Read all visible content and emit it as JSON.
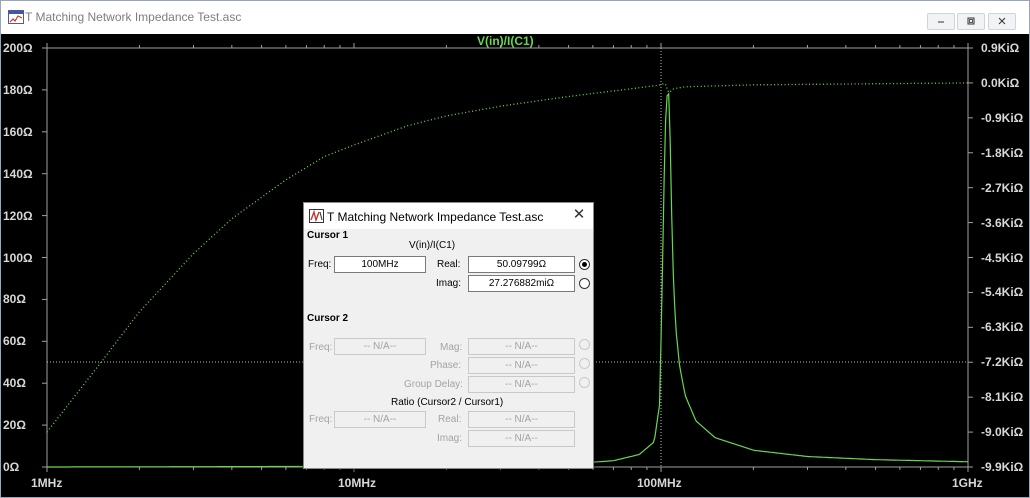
{
  "window": {
    "title": "T Matching Network Impedance Test.asc"
  },
  "chart_data": {
    "type": "line",
    "title": "V(in)/I(C1)",
    "xscale": "log",
    "xlim": [
      "1MHz",
      "1GHz"
    ],
    "x_ticks": [
      "1MHz",
      "10MHz",
      "100MHz",
      "1GHz"
    ],
    "ylim_left": [
      0,
      200
    ],
    "y_ticks_left": [
      "200Ω",
      "180Ω",
      "160Ω",
      "140Ω",
      "120Ω",
      "100Ω",
      "80Ω",
      "60Ω",
      "40Ω",
      "20Ω",
      "0Ω"
    ],
    "ylim_right": [
      -9.9,
      0.9
    ],
    "ylim_right_units": "KiΩ",
    "y_ticks_right": [
      "0.9KiΩ",
      "0.0KiΩ",
      "-0.9KiΩ",
      "-1.8KiΩ",
      "-2.7KiΩ",
      "-3.6KiΩ",
      "-4.5KiΩ",
      "-5.4KiΩ",
      "-6.3KiΩ",
      "-7.2KiΩ",
      "-8.1KiΩ",
      "-9.0KiΩ",
      "-9.9KiΩ"
    ],
    "grid": false,
    "series": [
      {
        "name": "V(in)/I(C1)",
        "part": "magnitude",
        "style": "solid",
        "color": "#67d84e",
        "axis": "left",
        "x_MHz": [
          1,
          10,
          50,
          70,
          85,
          95,
          99,
          101,
          103,
          105,
          106,
          107,
          108,
          109,
          110,
          112,
          115,
          120,
          130,
          150,
          200,
          300,
          500,
          1000
        ],
        "y_ohm": [
          0,
          0.3,
          1.5,
          3,
          6,
          12,
          30,
          90,
          160,
          180,
          178,
          160,
          130,
          105,
          85,
          65,
          48,
          34,
          22,
          14,
          8,
          5,
          3.5,
          2.5
        ]
      },
      {
        "name": "V(in)/I(C1)",
        "part": "phase",
        "style": "dotted",
        "color": "#67d84e",
        "axis": "right",
        "x_MHz": [
          1,
          1.5,
          2,
          3,
          4,
          6,
          8,
          10,
          15,
          20,
          30,
          50,
          80,
          100,
          103,
          106,
          110,
          120,
          200,
          1000
        ],
        "y_kiohm": [
          -9.0,
          -7.2,
          -5.9,
          -4.4,
          -3.5,
          -2.5,
          -1.9,
          -1.6,
          -1.1,
          -0.85,
          -0.6,
          -0.35,
          -0.15,
          -0.05,
          0.0,
          -0.25,
          -0.15,
          -0.1,
          -0.05,
          0.0
        ]
      }
    ],
    "cursors": {
      "x": "100MHz",
      "y": "50.09799Ω"
    }
  },
  "cursor_dialog": {
    "title": "T Matching Network Impedance Test.asc",
    "cursor1_header": "Cursor 1",
    "trace_name": "V(in)/I(C1)",
    "freq_label": "Freq:",
    "freq_value": "100MHz",
    "real_label": "Real:",
    "real_value": "50.09799Ω",
    "imag_label": "Imag:",
    "imag_value": "27.276882miΩ",
    "cursor2_header": "Cursor 2",
    "c2_freq_label": "Freq:",
    "c2_freq_value": "-- N/A--",
    "mag_label": "Mag:",
    "mag_value": "-- N/A--",
    "phase_label": "Phase:",
    "phase_value": "-- N/A--",
    "group_delay_label": "Group Delay:",
    "group_delay_value": "-- N/A--",
    "ratio_header": "Ratio (Cursor2 / Cursor1)",
    "r_freq_label": "Freq:",
    "r_freq_value": "-- N/A--",
    "r_real_label": "Real:",
    "r_real_value": "-- N/A--",
    "r_imag_label": "Imag:",
    "r_imag_value": "-- N/A--"
  },
  "icons": [
    "ltspice-plot-icon",
    "minimize-icon",
    "restore-icon",
    "close-icon",
    "ltspice-icon"
  ]
}
